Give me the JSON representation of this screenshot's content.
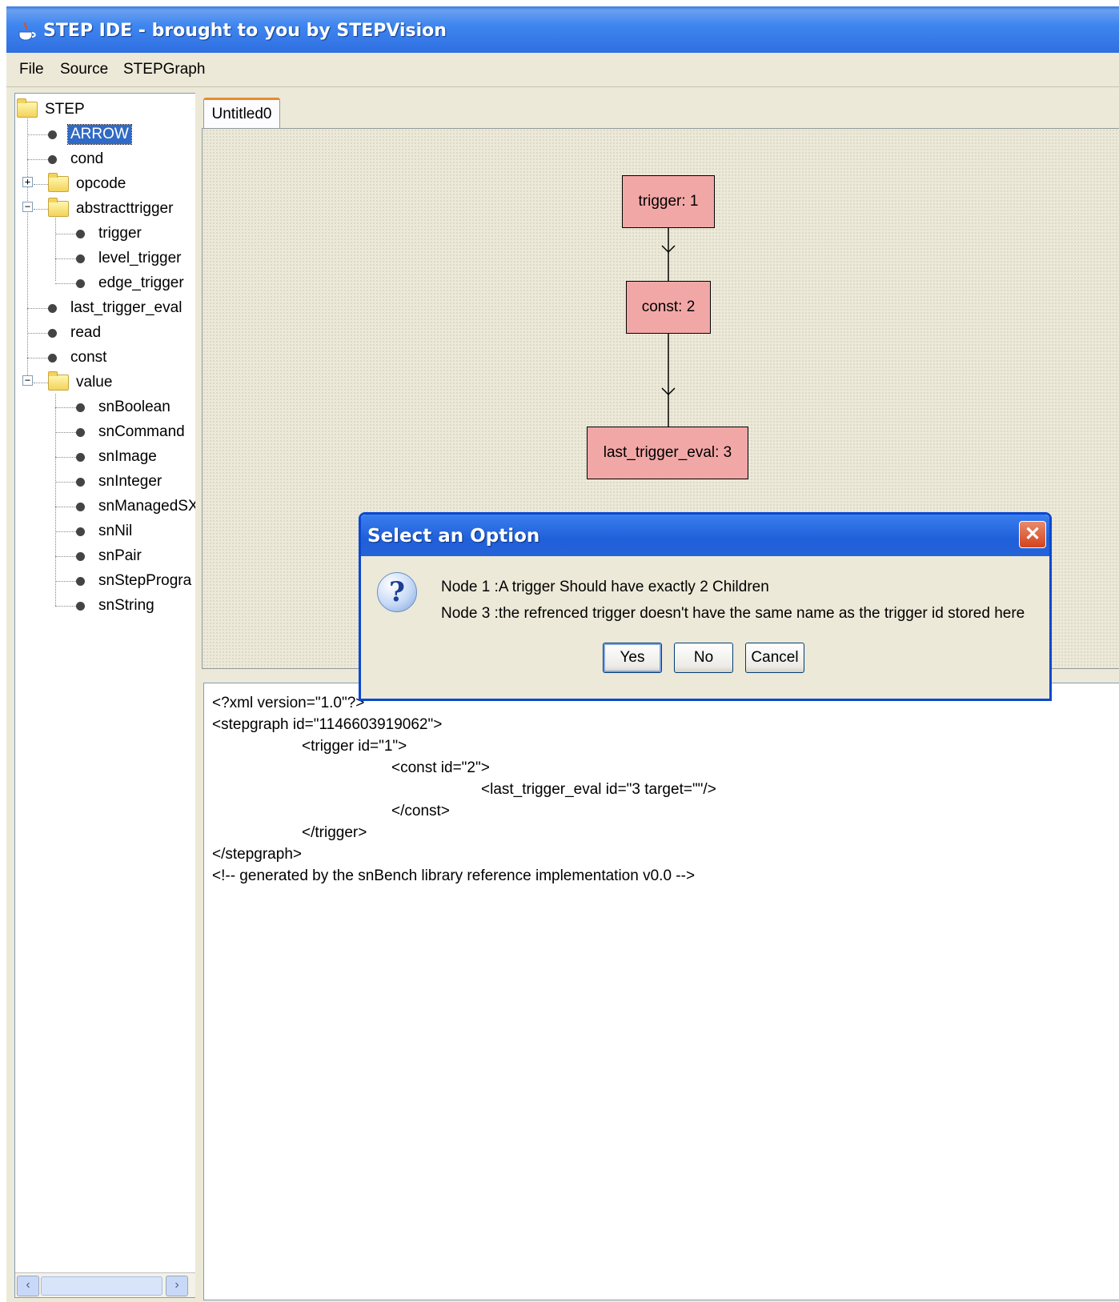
{
  "window": {
    "title": "STEP IDE - brought to you by STEPVision"
  },
  "menu": [
    "File",
    "Source",
    "STEPGraph"
  ],
  "tree": {
    "root": "STEP",
    "items": [
      "ARROW",
      "cond",
      "opcode",
      "abstracttrigger",
      "trigger",
      "level_trigger",
      "edge_trigger",
      "last_trigger_eval",
      "read",
      "const",
      "value",
      "snBoolean",
      "snCommand",
      "snImage",
      "snInteger",
      "snManagedSX",
      "snNil",
      "snPair",
      "snStepProgra",
      "snString"
    ],
    "selected": "ARROW"
  },
  "tab": {
    "label": "Untitled0"
  },
  "graph": {
    "nodes": [
      "trigger: 1",
      "const: 2",
      "last_trigger_eval: 3"
    ]
  },
  "xml": {
    "lines": [
      "<?xml version=\"1.0\"?>",
      "<stepgraph id=\"1146603919062\">",
      "<trigger id=\"1\">",
      "<const id=\"2\">",
      "<last_trigger_eval id=\"3 target=\"\"/>",
      "</const>",
      "</trigger>",
      "</stepgraph>",
      "<!-- generated by the snBench library reference implementation v0.0 -->"
    ]
  },
  "dialog": {
    "title": "Select an Option",
    "message1": "Node 1 :A trigger Should have exactly 2 Children",
    "message2": "Node 3 :the refrenced trigger doesn't have the same name as the trigger id stored here",
    "buttons": {
      "yes": "Yes",
      "no": "No",
      "cancel": "Cancel"
    }
  }
}
